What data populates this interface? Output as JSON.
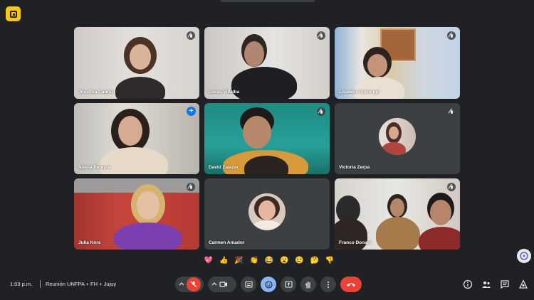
{
  "app": {
    "logo_name": "app-logo"
  },
  "tiles": [
    {
      "name": "Josefina Cabral",
      "speaking": false,
      "show_mic_off": true
    },
    {
      "name": "Lucas Villalba",
      "speaking": false,
      "show_mic_off": true
    },
    {
      "name": "Lisandro Torrengo",
      "speaking": false,
      "show_mic_off": true
    },
    {
      "name": "Noelia Pereyra",
      "speaking": true,
      "show_mic_off": false,
      "pinned_icon": "+"
    },
    {
      "name": "David Zalazar",
      "speaking": false,
      "show_mic_off": true
    },
    {
      "name": "Victoria Zerpa",
      "speaking": false,
      "show_mic_off": true
    },
    {
      "name": "Julia Kors",
      "speaking": false,
      "show_mic_off": true
    },
    {
      "name": "Carmen Amador",
      "speaking": false,
      "show_mic_off": false
    },
    {
      "name": "Franco Donato",
      "speaking": false,
      "show_mic_off": true
    }
  ],
  "reactions": [
    "💖",
    "👍",
    "🎉",
    "👏",
    "😂",
    "😮",
    "😢",
    "🤔",
    "👎"
  ],
  "bottom": {
    "time": "1:03 p.m.",
    "meeting_title": "Reunión UNFPA + FH + Jujuy"
  },
  "colors": {
    "background": "#202124",
    "tile": "#3c4043",
    "accent_blue": "#8ab4f8",
    "end_call_red": "#ea4335",
    "logo_yellow": "#f9c80e"
  }
}
